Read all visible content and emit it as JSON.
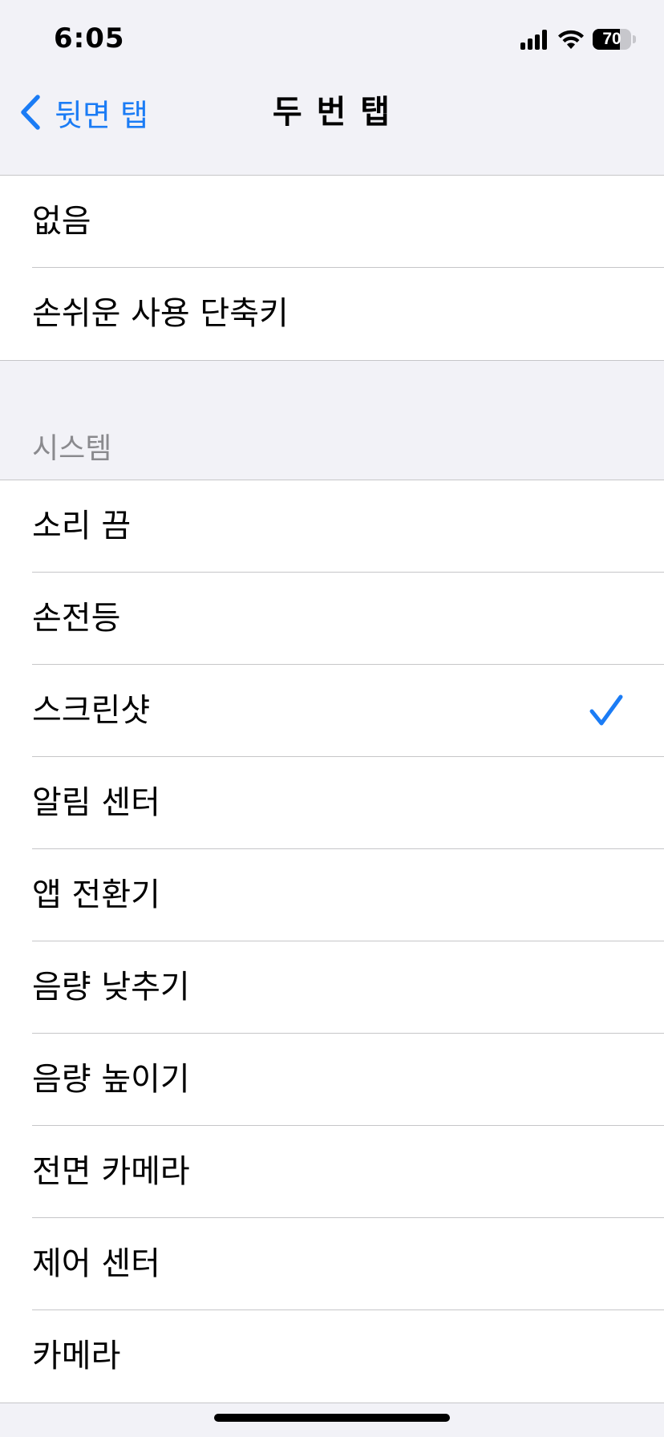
{
  "status_bar": {
    "time": "6:05",
    "battery_level": "70",
    "icons": [
      "cellular-signal-icon",
      "wifi-icon",
      "battery-icon"
    ]
  },
  "nav": {
    "back_label": "뒷면 탭",
    "title": "두 번 탭"
  },
  "group1": {
    "items": [
      {
        "label": "없음"
      },
      {
        "label": "손쉬운 사용 단축키"
      }
    ]
  },
  "system_section": {
    "header": "시스템",
    "items": [
      {
        "label": "소리 끔",
        "selected": false
      },
      {
        "label": "손전등",
        "selected": false
      },
      {
        "label": "스크린샷",
        "selected": true
      },
      {
        "label": "알림 센터",
        "selected": false
      },
      {
        "label": "앱 전환기",
        "selected": false
      },
      {
        "label": "음량 낮추기",
        "selected": false
      },
      {
        "label": "음량 높이기",
        "selected": false
      },
      {
        "label": "전면 카메라",
        "selected": false
      },
      {
        "label": "제어 센터",
        "selected": false
      },
      {
        "label": "카메라",
        "selected": false
      }
    ]
  },
  "colors": {
    "accent": "#1b7cf5",
    "background": "#f2f2f7",
    "separator": "#c6c6c8",
    "section_header": "#8a8a8e"
  }
}
